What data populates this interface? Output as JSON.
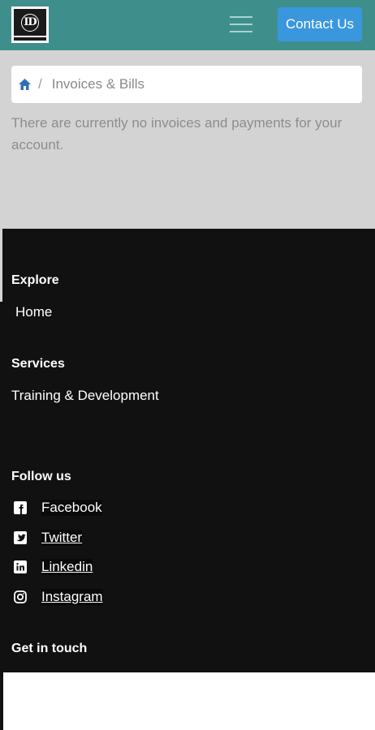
{
  "header": {
    "logo_icon": "company-logo",
    "menu_icon": "hamburger-menu-icon",
    "contact_label": "Contact Us",
    "colors": {
      "bar": "#3e8f8c",
      "button": "#3a97de"
    }
  },
  "breadcrumb": {
    "home_icon": "home-icon",
    "separator": "/",
    "current": "Invoices & Bills"
  },
  "main": {
    "message": "There are currently no invoices and payments for your account."
  },
  "footer": {
    "explore": {
      "heading": "Explore",
      "links": [
        "Home"
      ]
    },
    "services": {
      "heading": "Services",
      "links": [
        "Training & Development"
      ]
    },
    "follow": {
      "heading": "Follow us",
      "items": [
        {
          "label": "Facebook",
          "icon": "facebook-icon"
        },
        {
          "label": "Twitter",
          "icon": "twitter-icon"
        },
        {
          "label": "Linkedin",
          "icon": "linkedin-icon"
        },
        {
          "label": "Instagram",
          "icon": "instagram-icon"
        }
      ]
    },
    "contact": {
      "heading": "Get in touch"
    }
  }
}
